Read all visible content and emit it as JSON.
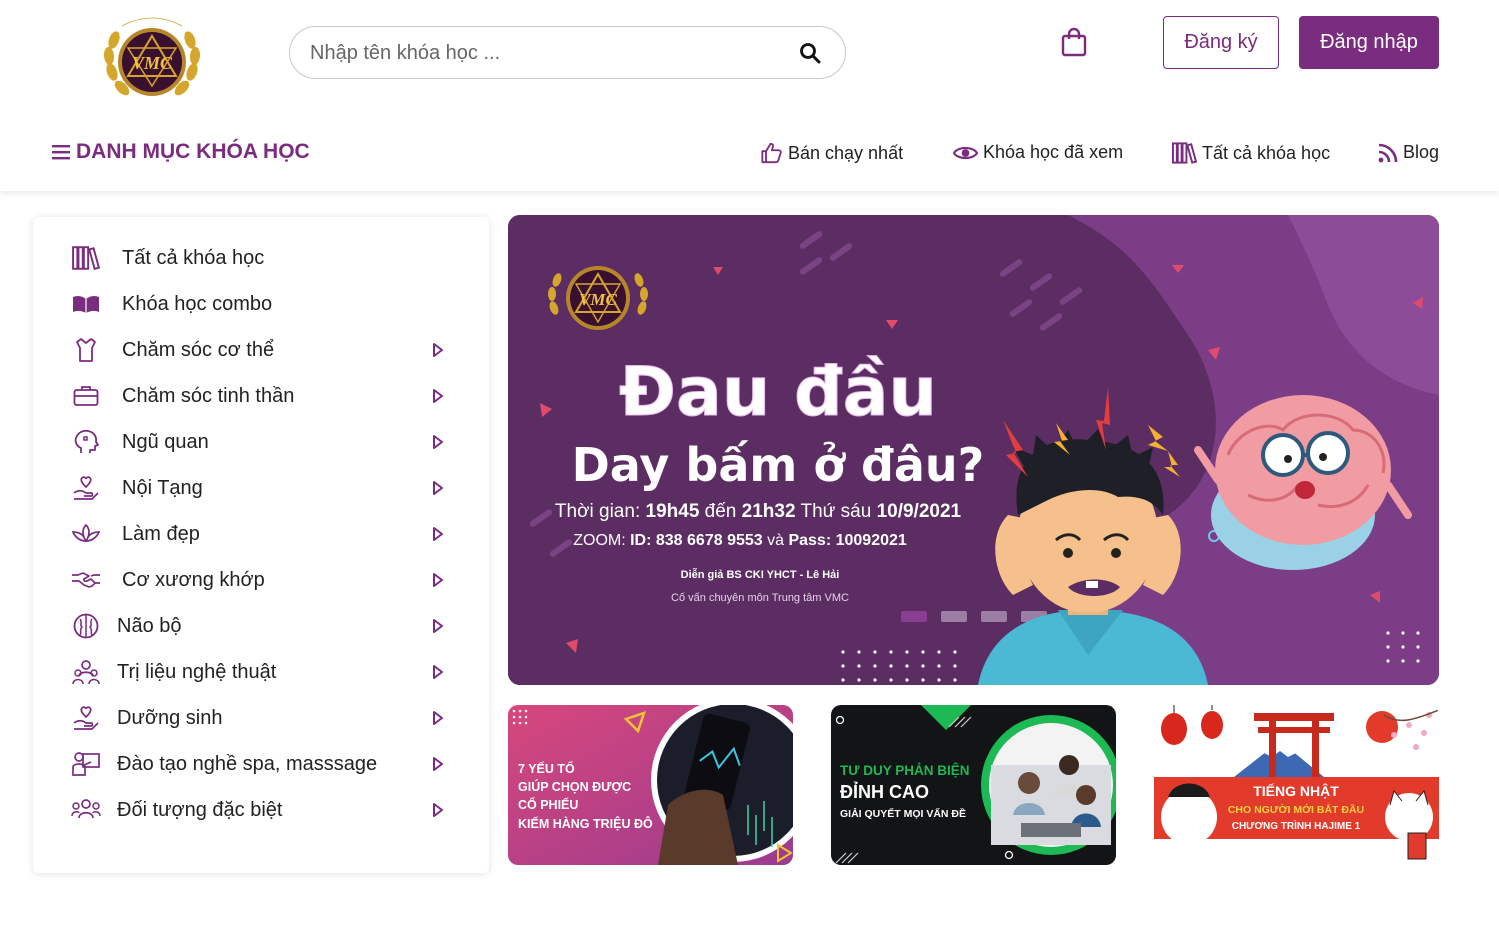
{
  "header": {
    "logo_alt": "VMC",
    "search": {
      "placeholder": "Nhập tên khóa học ...",
      "value": ""
    },
    "register_label": "Đăng ký",
    "login_label": "Đăng nhập"
  },
  "category_menu": {
    "label": "DANH MỤC KHÓA HỌC"
  },
  "nav": [
    {
      "label": "Bán chạy nhất",
      "icon": "thumbs-up-icon"
    },
    {
      "label": "Khóa học đã xem",
      "icon": "eye-icon"
    },
    {
      "label": "Tất cả khóa học",
      "icon": "books-icon"
    },
    {
      "label": "Blog",
      "icon": "rss-icon"
    }
  ],
  "sidebar": {
    "items": [
      {
        "label": "Tất cả khóa học",
        "icon": "books-icon",
        "has_submenu": false
      },
      {
        "label": "Khóa học combo",
        "icon": "open-book-icon",
        "has_submenu": false
      },
      {
        "label": "Chăm sóc cơ thể",
        "icon": "shirt-icon",
        "has_submenu": true
      },
      {
        "label": "Chăm sóc tinh thần",
        "icon": "briefcase-icon",
        "has_submenu": true
      },
      {
        "label": "Ngũ quan",
        "icon": "head-icon",
        "has_submenu": true
      },
      {
        "label": "Nội Tạng",
        "icon": "hand-heart-icon",
        "has_submenu": true
      },
      {
        "label": "Làm đẹp",
        "icon": "lotus-icon",
        "has_submenu": true
      },
      {
        "label": "Cơ xương khớp",
        "icon": "handshake-icon",
        "has_submenu": true
      },
      {
        "label": "Não bộ",
        "icon": "brain-icon",
        "has_submenu": true
      },
      {
        "label": "Trị liệu nghệ thuật",
        "icon": "people-icon",
        "has_submenu": true
      },
      {
        "label": "Dưỡng sinh",
        "icon": "hand-heart-icon",
        "has_submenu": true
      },
      {
        "label": "Đào tạo nghề spa, masssage",
        "icon": "teacher-icon",
        "has_submenu": true
      },
      {
        "label": "Đối tượng đặc biệt",
        "icon": "group-icon",
        "has_submenu": true
      }
    ]
  },
  "banner": {
    "logo_text": "VMC",
    "title_line1": "Đau đầu",
    "title_line2": "Day bấm ở đâu?",
    "time_prefix": "Thời gian: ",
    "time_start": "19h45",
    "time_mid": " đến ",
    "time_end": "21h32",
    "time_day": " Thứ sáu ",
    "time_date": "10/9/2021",
    "zoom_prefix": "ZOOM: ",
    "zoom_id": "ID: 838 6678 9553",
    "zoom_and": " và ",
    "zoom_pass": "Pass: 10092021",
    "speaker": "Diễn giả BS CKI YHCT - Lê Hải",
    "speaker_role": "Cố vấn chuyên môn Trung tâm VMC",
    "slides": 4,
    "active_slide": 1
  },
  "promos": [
    {
      "lines": [
        "7 YẾU TỐ",
        "GIÚP CHỌN ĐƯỢC",
        "CỔ PHIẾU",
        "KIẾM HÀNG TRIỆU ĐÔ"
      ]
    },
    {
      "line1": "TƯ DUY PHẢN BIỆN",
      "line2": "ĐỈNH CAO",
      "line3": "GIẢI QUYẾT MỌI VẤN ĐỀ"
    },
    {
      "line1": "TIẾNG NHẬT",
      "line2": "CHO NGƯỜI MỚI BẮT ĐẦU",
      "line3": "CHƯƠNG TRÌNH HAJIME 1"
    }
  ],
  "colors": {
    "brand": "#7a2c7f",
    "banner_bg": "#5b2d62",
    "accent_green": "#1db954"
  }
}
